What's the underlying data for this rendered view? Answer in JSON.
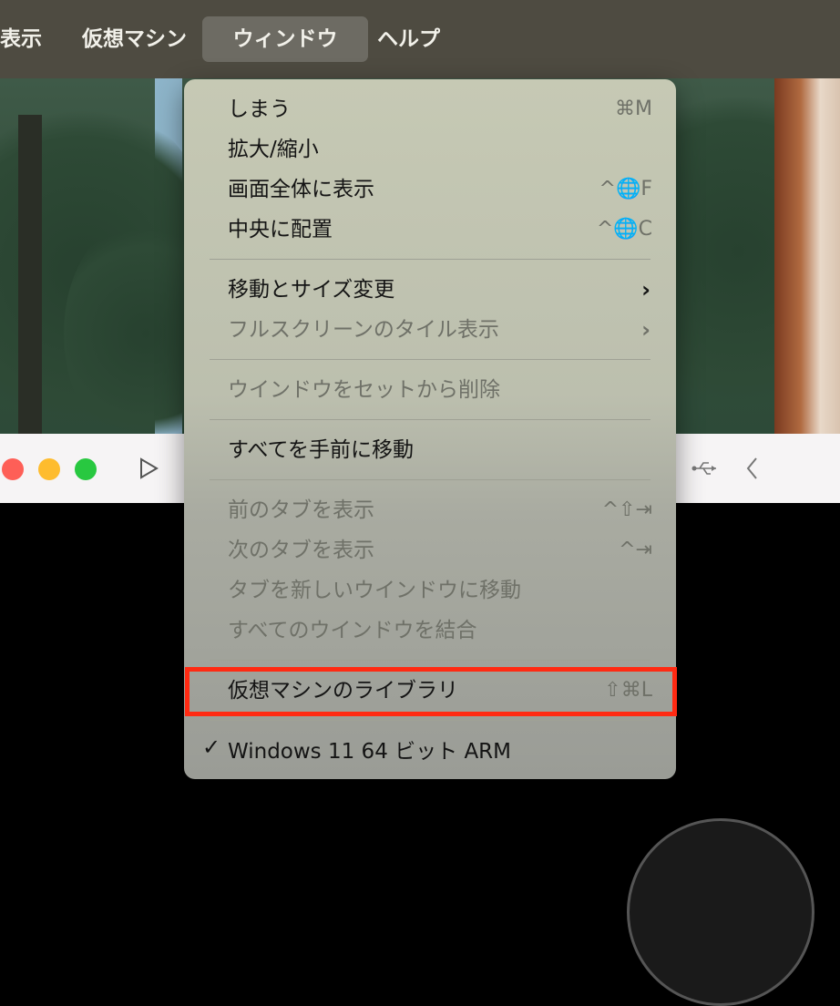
{
  "menubar": {
    "items": [
      "表示",
      "仮想マシン",
      "ウィンドウ",
      "ヘルプ"
    ]
  },
  "menu": {
    "items": [
      {
        "label": "しまう",
        "shortcut": "⌘M",
        "enabled": true
      },
      {
        "label": "拡大/縮小",
        "shortcut": "",
        "enabled": true
      },
      {
        "label": "画面全体に表示",
        "shortcut": "^🌐F",
        "enabled": true
      },
      {
        "label": "中央に配置",
        "shortcut": "^🌐C",
        "enabled": true
      },
      {
        "label": "移動とサイズ変更",
        "submenu": true,
        "enabled": true
      },
      {
        "label": "フルスクリーンのタイル表示",
        "submenu": true,
        "enabled": false
      },
      {
        "label": "ウインドウをセットから削除",
        "enabled": false
      },
      {
        "label": "すべてを手前に移動",
        "enabled": true
      },
      {
        "label": "前のタブを表示",
        "shortcut": "^⇧⇥",
        "enabled": false
      },
      {
        "label": "次のタブを表示",
        "shortcut": "^⇥",
        "enabled": false
      },
      {
        "label": "タブを新しいウインドウに移動",
        "enabled": false
      },
      {
        "label": "すべてのウインドウを結合",
        "enabled": false
      },
      {
        "label": "仮想マシンのライブラリ",
        "shortcut": "⇧⌘L",
        "enabled": true
      },
      {
        "label": "Windows 11 64 ビット ARM",
        "checked": true,
        "enabled": true
      }
    ],
    "check_mark": "✓",
    "chevron": "›"
  },
  "colors": {
    "highlight": "#ff2a12",
    "close": "#fe5f57",
    "minimize": "#febc2e",
    "zoom": "#28c840"
  },
  "icons": [
    "close-button",
    "minimize-button",
    "zoom-button",
    "play-icon",
    "usb-icon",
    "chevron-left-icon"
  ]
}
